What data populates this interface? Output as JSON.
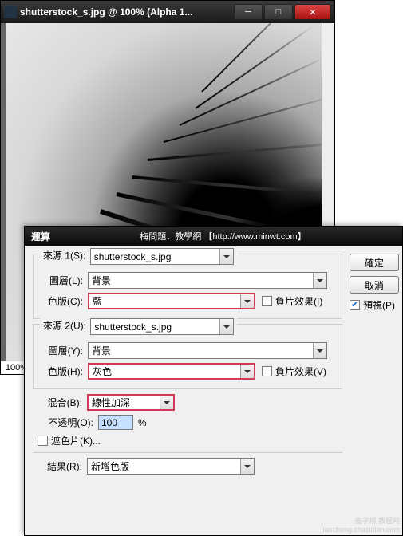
{
  "image_window": {
    "title": "shutterstock_s.jpg @ 100% (Alpha 1...",
    "zoom": "100%"
  },
  "dialog": {
    "title": "運算",
    "subtitle": "梅問題．教學網  【http://www.minwt.com】",
    "source1": {
      "legend": "來源 1(S):",
      "file": "shutterstock_s.jpg",
      "layer_label": "圖層(L):",
      "layer": "背景",
      "channel_label": "色版(C):",
      "channel": "藍",
      "invert_label": "負片效果(I)"
    },
    "source2": {
      "legend": "來源 2(U):",
      "file": "shutterstock_s.jpg",
      "layer_label": "圖層(Y):",
      "layer": "背景",
      "channel_label": "色版(H):",
      "channel": "灰色",
      "invert_label": "負片效果(V)"
    },
    "blend": {
      "label": "混合(B):",
      "mode": "線性加深",
      "opacity_label": "不透明(O):",
      "opacity": "100",
      "opacity_unit": "%",
      "mask_label": "遮色片(K)..."
    },
    "result": {
      "label": "結果(R):",
      "value": "新增色版"
    },
    "buttons": {
      "ok": "確定",
      "cancel": "取消",
      "preview": "預視(P)"
    }
  },
  "watermark": {
    "line1": "查字規 教程网",
    "line2": "jiaocheng.chazidian.com"
  }
}
